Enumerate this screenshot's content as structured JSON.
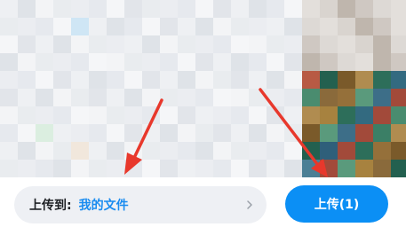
{
  "bottom_bar": {
    "upload_to_label": "上传到:",
    "destination_folder": "我的文件",
    "chevron_icon": "chevron-right-icon",
    "upload_button_label": "上传(1)"
  },
  "colors": {
    "accent": "#0b8ff5",
    "folder_text": "#1a8cf0",
    "pill_background": "#eef0f4",
    "annotation_arrow": "#e8382c"
  }
}
